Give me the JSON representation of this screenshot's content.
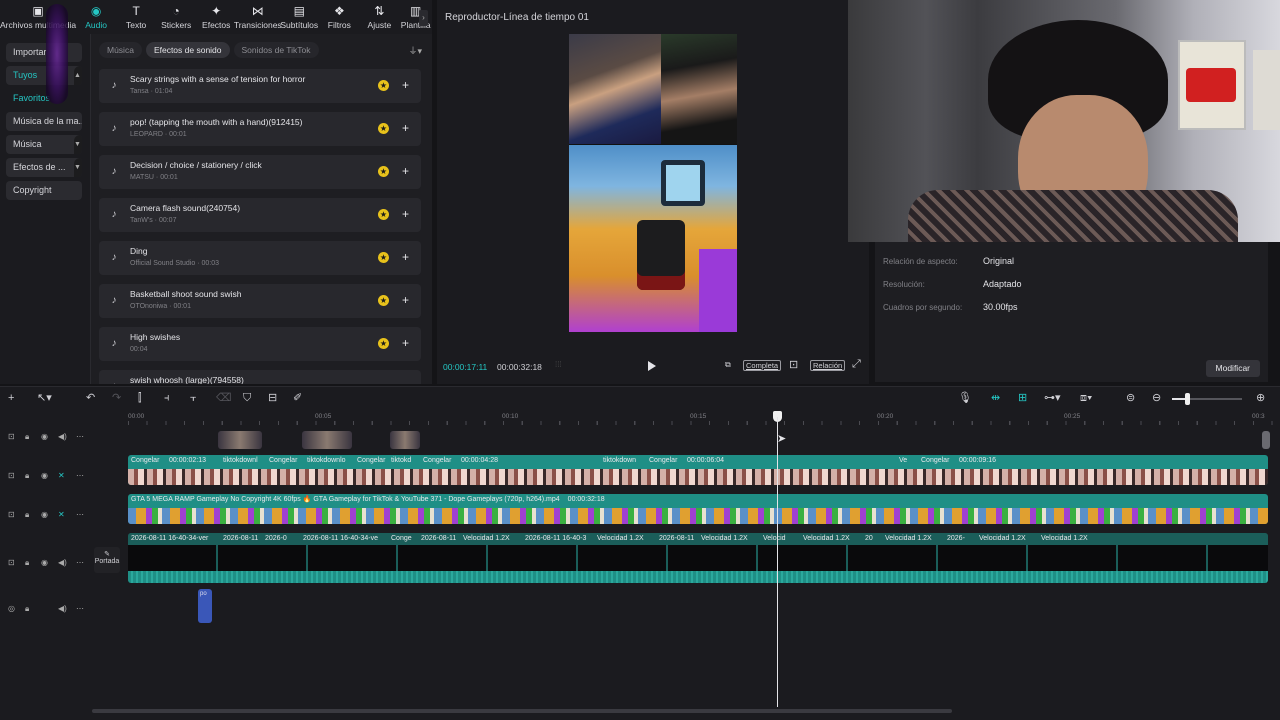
{
  "toolbar": {
    "tools": [
      {
        "label": "Archivos multimedia",
        "icon": "media-icon"
      },
      {
        "label": "Audio",
        "icon": "audio-icon"
      },
      {
        "label": "Texto",
        "icon": "text-icon"
      },
      {
        "label": "Stickers",
        "icon": "stickers-icon"
      },
      {
        "label": "Efectos",
        "icon": "effects-icon"
      },
      {
        "label": "Transiciones",
        "icon": "transitions-icon"
      },
      {
        "label": "Subtítulos",
        "icon": "subtitles-icon"
      },
      {
        "label": "Filtros",
        "icon": "filters-icon"
      },
      {
        "label": "Ajuste",
        "icon": "adjust-icon"
      },
      {
        "label": "Plantilla",
        "icon": "templates-icon"
      }
    ],
    "active_index": 1
  },
  "sidenav": {
    "items": [
      "Importar",
      "Tuyos",
      "Favoritos",
      "Música de la ma...",
      "Música",
      "Efectos de ...",
      "Copyright"
    ]
  },
  "library": {
    "tabs": [
      "Música",
      "Efectos de sonido",
      "Sonidos de TikTok"
    ],
    "active_tab": 1,
    "sounds": [
      {
        "title": "Scary strings with a sense of tension for horror",
        "sub": "Tansa · 01:04"
      },
      {
        "title": "pop! (tapping the mouth with a hand)(912415)",
        "sub": "LEOPARD · 00:01"
      },
      {
        "title": "Decision / choice / stationery / click",
        "sub": "MATSU · 00:01"
      },
      {
        "title": "Camera flash sound(240754)",
        "sub": "TanW's · 00:07"
      },
      {
        "title": "Ding",
        "sub": "Official Sound Studio · 00:03"
      },
      {
        "title": "Basketball shoot sound swish",
        "sub": "OTOnoniwa · 00:01"
      },
      {
        "title": "High swishes",
        "sub": "00:04"
      },
      {
        "title": "swish whoosh (large)(794558)",
        "sub": ""
      }
    ]
  },
  "player": {
    "title": "Reproductor-Línea de tiempo 01",
    "current_time": "00:00:17:11",
    "total_time": "00:00:32:18",
    "complete_label": "Completa",
    "ratio_label": "Relación"
  },
  "properties": {
    "rows": [
      {
        "label": "Relación de aspecto:",
        "value": "Original"
      },
      {
        "label": "Resolución:",
        "value": "Adaptado"
      },
      {
        "label": "Cuadros por segundo:",
        "value": "30.00fps"
      }
    ],
    "modify_label": "Modificar"
  },
  "timeline": {
    "ruler": [
      "00:00",
      "00:05",
      "00:10",
      "00:15",
      "00:20",
      "00:25",
      "00:3"
    ],
    "portada_label": "Portada",
    "track_cam": {
      "labels": [
        "Congelar",
        "00:00:02:13",
        "tiktokdownl",
        "Congelar",
        "tiktokdownlo",
        "Congelar",
        "tiktokd",
        "Congelar",
        "00:00:04:28",
        "tiktokdown",
        "Congelar",
        "00:00:06:04",
        "Ve",
        "Congelar",
        "00:00:09:16"
      ]
    },
    "track_game": {
      "label": "GTA 5 MEGA RAMP Gameplay No Copyright 4K 60fps 🔥 GTA Gameplay for TikTok & YouTube  371 - Dope Gameplays (720p, h264).mp4",
      "duration": "00:00:32:18"
    },
    "track_main": {
      "labels": [
        "2026-08-11 16-40-34-ver",
        "2026-08-11",
        "2026-0",
        "2026-08-11 16-40-34-ve",
        "Conge",
        "2026-08-11",
        "Velocidad 1.2X",
        "2026-08-11 16-40-3",
        "Velocidad 1.2X",
        "2026-08-11",
        "Velocidad 1.2X",
        "Velocid",
        "Velocidad 1.2X",
        "20",
        "Velocidad 1.2X",
        "2026-",
        "Velocidad 1.2X",
        "Velocidad 1.2X"
      ]
    },
    "audio_clip_label": "po"
  },
  "colors": {
    "accent": "#25c7c4",
    "clip_teal": "#1f8f86",
    "clip_dark": "#1b5e5a",
    "audio_blue": "#3a57b8",
    "star": "#e8c21b"
  }
}
